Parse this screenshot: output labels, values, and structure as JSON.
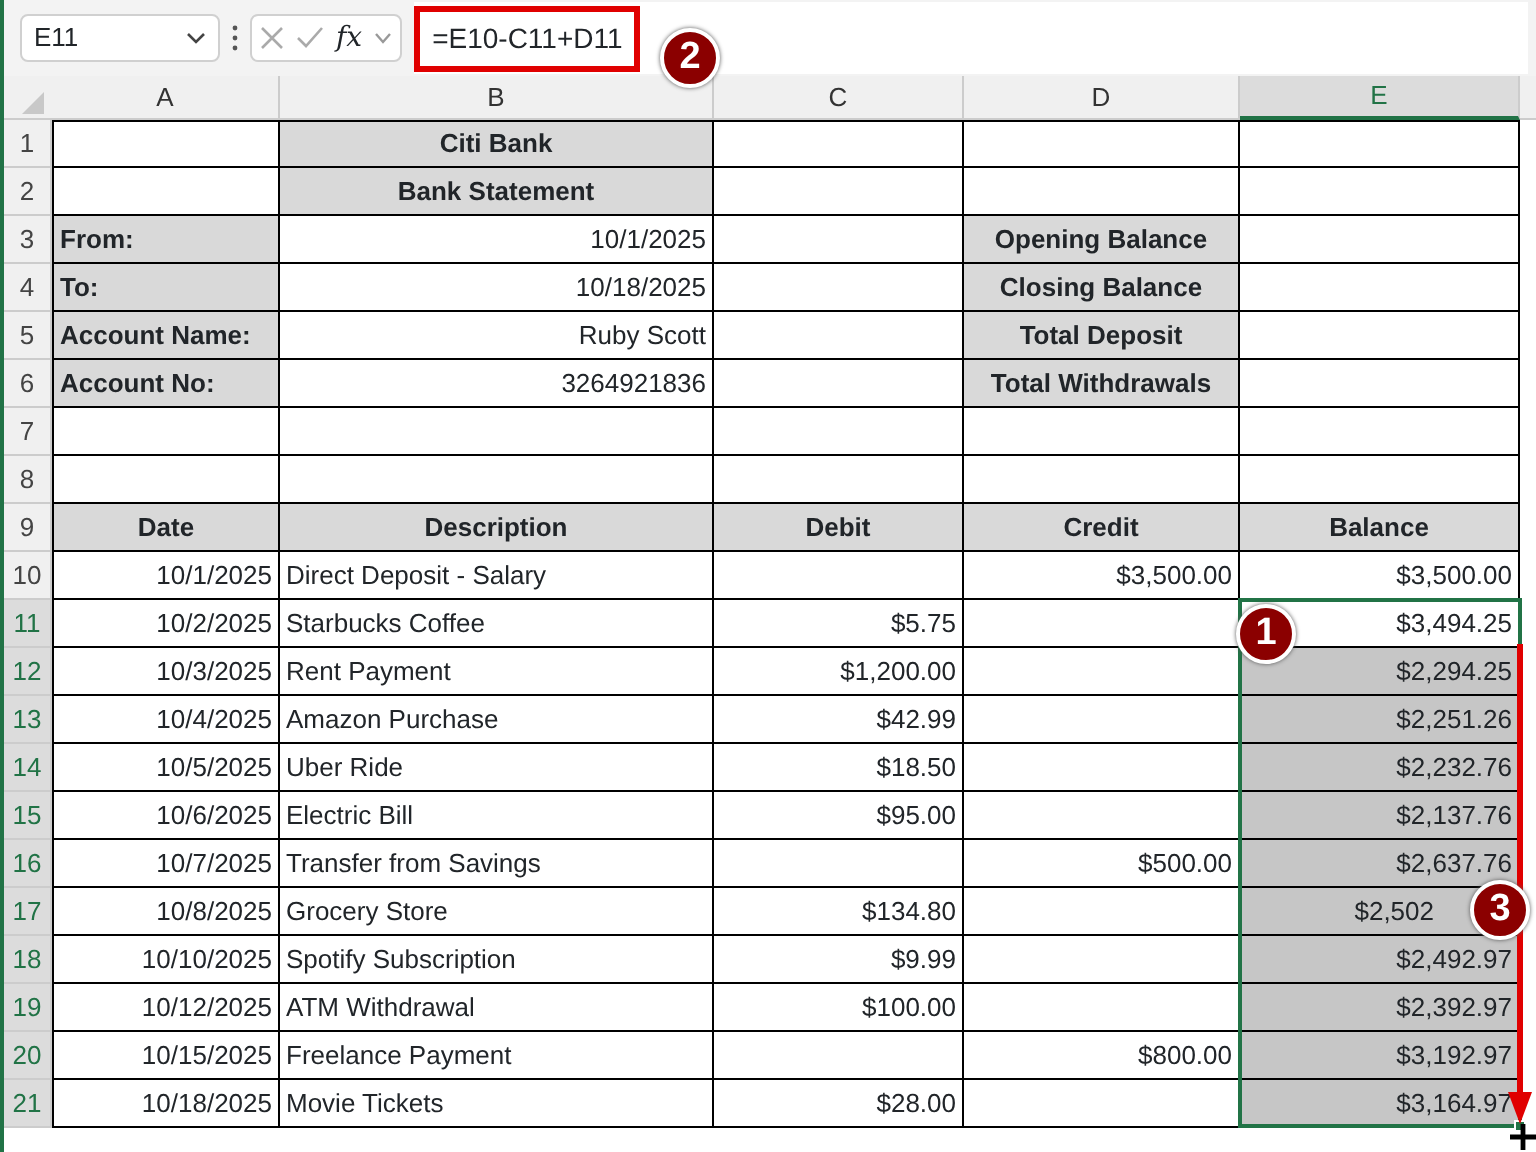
{
  "name_box": {
    "value": "E11"
  },
  "formula_bar": {
    "fx_label": "fx",
    "formula": "=E10-C11+D11",
    "highlighted": true
  },
  "columns": [
    {
      "label": "A",
      "selected": false
    },
    {
      "label": "B",
      "selected": false
    },
    {
      "label": "C",
      "selected": false
    },
    {
      "label": "D",
      "selected": false
    },
    {
      "label": "E",
      "selected": true
    }
  ],
  "rows": [
    {
      "number": "1",
      "selected": false,
      "cells": [
        {
          "kind": "empty"
        },
        {
          "kind": "heading",
          "text": "Citi Bank"
        },
        {
          "kind": "empty"
        },
        {
          "kind": "empty"
        },
        {
          "kind": "empty"
        }
      ]
    },
    {
      "number": "2",
      "selected": false,
      "cells": [
        {
          "kind": "empty"
        },
        {
          "kind": "heading",
          "text": "Bank Statement"
        },
        {
          "kind": "empty"
        },
        {
          "kind": "empty"
        },
        {
          "kind": "empty"
        }
      ]
    },
    {
      "number": "3",
      "selected": false,
      "cells": [
        {
          "kind": "label",
          "text": "From:"
        },
        {
          "kind": "value",
          "text": "10/1/2025"
        },
        {
          "kind": "empty"
        },
        {
          "kind": "heading",
          "text": "Opening Balance"
        },
        {
          "kind": "empty"
        }
      ]
    },
    {
      "number": "4",
      "selected": false,
      "cells": [
        {
          "kind": "label",
          "text": "To:"
        },
        {
          "kind": "value",
          "text": "10/18/2025"
        },
        {
          "kind": "empty"
        },
        {
          "kind": "heading",
          "text": "Closing Balance"
        },
        {
          "kind": "empty"
        }
      ]
    },
    {
      "number": "5",
      "selected": false,
      "cells": [
        {
          "kind": "label",
          "text": "Account Name:"
        },
        {
          "kind": "value",
          "text": "Ruby Scott"
        },
        {
          "kind": "empty"
        },
        {
          "kind": "heading",
          "text": "Total Deposit"
        },
        {
          "kind": "empty"
        }
      ]
    },
    {
      "number": "6",
      "selected": false,
      "cells": [
        {
          "kind": "label",
          "text": "Account No:"
        },
        {
          "kind": "value",
          "text": "3264921836"
        },
        {
          "kind": "empty"
        },
        {
          "kind": "heading",
          "text": "Total Withdrawals"
        },
        {
          "kind": "empty"
        }
      ]
    },
    {
      "number": "7",
      "selected": false,
      "cells": [
        {
          "kind": "empty"
        },
        {
          "kind": "empty"
        },
        {
          "kind": "empty"
        },
        {
          "kind": "empty"
        },
        {
          "kind": "empty"
        }
      ]
    },
    {
      "number": "8",
      "selected": false,
      "cells": [
        {
          "kind": "empty"
        },
        {
          "kind": "empty"
        },
        {
          "kind": "empty"
        },
        {
          "kind": "empty"
        },
        {
          "kind": "empty"
        }
      ]
    },
    {
      "number": "9",
      "selected": false,
      "cells": [
        {
          "kind": "heading",
          "text": "Date"
        },
        {
          "kind": "heading",
          "text": "Description"
        },
        {
          "kind": "heading",
          "text": "Debit"
        },
        {
          "kind": "heading",
          "text": "Credit"
        },
        {
          "kind": "heading",
          "text": "Balance"
        }
      ]
    },
    {
      "number": "10",
      "selected": false,
      "cells": [
        {
          "kind": "value",
          "text": "10/1/2025"
        },
        {
          "kind": "text",
          "text": "Direct Deposit - Salary"
        },
        {
          "kind": "empty"
        },
        {
          "kind": "value",
          "text": "$3,500.00"
        },
        {
          "kind": "value",
          "text": "$3,500.00"
        }
      ]
    },
    {
      "number": "11",
      "selected": true,
      "cells": [
        {
          "kind": "value",
          "text": "10/2/2025"
        },
        {
          "kind": "text",
          "text": "Starbucks Coffee"
        },
        {
          "kind": "value",
          "text": "$5.75"
        },
        {
          "kind": "empty"
        },
        {
          "kind": "value",
          "text": "$3,494.25",
          "selected": true,
          "active": true
        }
      ]
    },
    {
      "number": "12",
      "selected": true,
      "cells": [
        {
          "kind": "value",
          "text": "10/3/2025"
        },
        {
          "kind": "text",
          "text": "Rent Payment"
        },
        {
          "kind": "value",
          "text": "$1,200.00"
        },
        {
          "kind": "empty"
        },
        {
          "kind": "value",
          "text": "$2,294.25",
          "selected": true,
          "active": false
        }
      ]
    },
    {
      "number": "13",
      "selected": true,
      "cells": [
        {
          "kind": "value",
          "text": "10/4/2025"
        },
        {
          "kind": "text",
          "text": "Amazon Purchase"
        },
        {
          "kind": "value",
          "text": "$42.99"
        },
        {
          "kind": "empty"
        },
        {
          "kind": "value",
          "text": "$2,251.26",
          "selected": true,
          "active": false
        }
      ]
    },
    {
      "number": "14",
      "selected": true,
      "cells": [
        {
          "kind": "value",
          "text": "10/5/2025"
        },
        {
          "kind": "text",
          "text": "Uber Ride"
        },
        {
          "kind": "value",
          "text": "$18.50"
        },
        {
          "kind": "empty"
        },
        {
          "kind": "value",
          "text": "$2,232.76",
          "selected": true,
          "active": false
        }
      ]
    },
    {
      "number": "15",
      "selected": true,
      "cells": [
        {
          "kind": "value",
          "text": "10/6/2025"
        },
        {
          "kind": "text",
          "text": "Electric Bill"
        },
        {
          "kind": "value",
          "text": "$95.00"
        },
        {
          "kind": "empty"
        },
        {
          "kind": "value",
          "text": "$2,137.76",
          "selected": true,
          "active": false
        }
      ]
    },
    {
      "number": "16",
      "selected": true,
      "cells": [
        {
          "kind": "value",
          "text": "10/7/2025"
        },
        {
          "kind": "text",
          "text": "Transfer from Savings"
        },
        {
          "kind": "empty"
        },
        {
          "kind": "value",
          "text": "$500.00"
        },
        {
          "kind": "value",
          "text": "$2,637.76",
          "selected": true,
          "active": false
        }
      ]
    },
    {
      "number": "17",
      "selected": true,
      "cells": [
        {
          "kind": "value",
          "text": "10/8/2025"
        },
        {
          "kind": "text",
          "text": "Grocery Store"
        },
        {
          "kind": "value",
          "text": "$134.80"
        },
        {
          "kind": "empty"
        },
        {
          "kind": "covered",
          "text": "$2,502",
          "selected": true,
          "active": false
        }
      ]
    },
    {
      "number": "18",
      "selected": true,
      "cells": [
        {
          "kind": "value",
          "text": "10/10/2025"
        },
        {
          "kind": "text",
          "text": "Spotify Subscription"
        },
        {
          "kind": "value",
          "text": "$9.99"
        },
        {
          "kind": "empty"
        },
        {
          "kind": "value",
          "text": "$2,492.97",
          "selected": true,
          "active": false
        }
      ]
    },
    {
      "number": "19",
      "selected": true,
      "cells": [
        {
          "kind": "value",
          "text": "10/12/2025"
        },
        {
          "kind": "text",
          "text": "ATM Withdrawal"
        },
        {
          "kind": "value",
          "text": "$100.00"
        },
        {
          "kind": "empty"
        },
        {
          "kind": "value",
          "text": "$2,392.97",
          "selected": true,
          "active": false
        }
      ]
    },
    {
      "number": "20",
      "selected": true,
      "cells": [
        {
          "kind": "value",
          "text": "10/15/2025"
        },
        {
          "kind": "text",
          "text": "Freelance Payment"
        },
        {
          "kind": "empty"
        },
        {
          "kind": "value",
          "text": "$800.00"
        },
        {
          "kind": "value",
          "text": "$3,192.97",
          "selected": true,
          "active": false
        }
      ]
    },
    {
      "number": "21",
      "selected": true,
      "cells": [
        {
          "kind": "value",
          "text": "10/18/2025"
        },
        {
          "kind": "text",
          "text": "Movie Tickets"
        },
        {
          "kind": "value",
          "text": "$28.00"
        },
        {
          "kind": "empty"
        },
        {
          "kind": "value",
          "text": "$3,164.97",
          "selected": true,
          "active": false
        }
      ]
    }
  ],
  "callouts": [
    {
      "label": "1"
    },
    {
      "label": "2"
    },
    {
      "label": "3"
    }
  ]
}
